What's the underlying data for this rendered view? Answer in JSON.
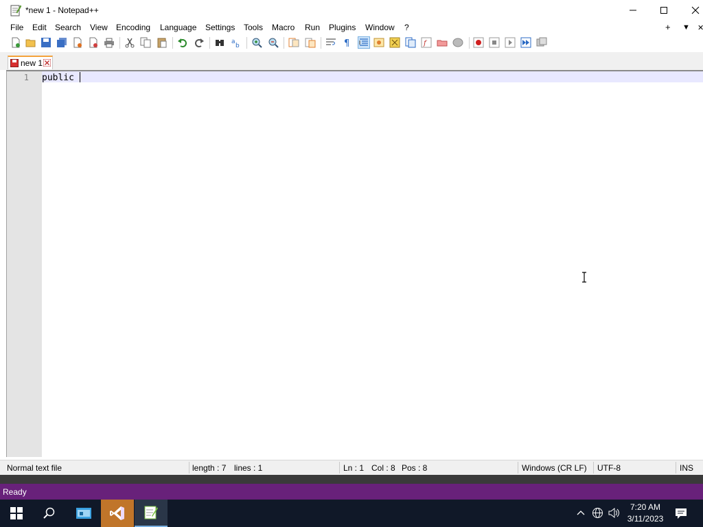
{
  "window": {
    "title": "*new 1 - Notepad++",
    "minimize_icon": "minimize-icon",
    "maximize_icon": "maximize-icon",
    "close_icon": "close-icon"
  },
  "menu": {
    "items": [
      "File",
      "Edit",
      "Search",
      "View",
      "Encoding",
      "Language",
      "Settings",
      "Tools",
      "Macro",
      "Run",
      "Plugins",
      "Window",
      "?"
    ],
    "right": [
      "+",
      "▼",
      "✕"
    ]
  },
  "tabs": [
    {
      "label": "new 1",
      "modified": true
    }
  ],
  "editor": {
    "line_numbers": [
      "1"
    ],
    "text": "public "
  },
  "statusbar": {
    "file_type": "Normal text file",
    "length": "length : 7",
    "lines": "lines : 1",
    "ln": "Ln : 1",
    "col": "Col : 8",
    "pos": "Pos : 8",
    "eol": "Windows (CR LF)",
    "encoding": "UTF-8",
    "mode": "INS"
  },
  "vs_status": {
    "text": "Ready",
    "color": "#68217a"
  },
  "taskbar": {
    "time": "7:20 AM",
    "date": "3/11/2023",
    "apps": [
      "start-icon",
      "search-icon",
      "file-explorer-icon",
      "visual-studio-icon",
      "notepadpp-icon"
    ]
  },
  "colors": {
    "accent_tab": "#f4a23a",
    "current_line": "#e8e8ff",
    "taskbar": "#101828"
  }
}
